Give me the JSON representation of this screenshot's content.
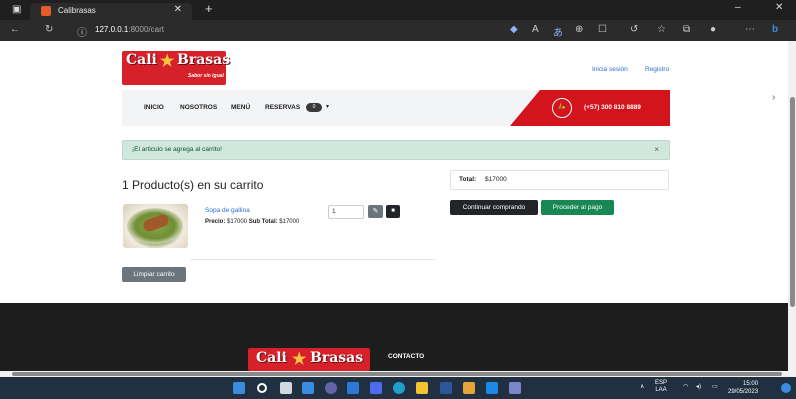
{
  "browser": {
    "tab_title": "Calibrasas",
    "tab_close": "✕",
    "new_tab": "+",
    "url_host": "127.0.0.1",
    "url_rest": ":8000/cart",
    "window": {
      "minimize": "–",
      "close": "✕"
    }
  },
  "site": {
    "logo": {
      "word1": "Cali",
      "word2": "Brasas",
      "tagline": "Sabor sin igual"
    },
    "links": {
      "login": "Inicia sesión",
      "register": "Registro"
    },
    "nav": {
      "items": [
        "INICIO",
        "NOSOTROS",
        "MENÚ",
        "RESERVAS"
      ],
      "badge": "0",
      "caret": "▾",
      "phone_icon": "🛵",
      "phone": "(+57) 300 810 8889"
    }
  },
  "alert": {
    "message": "¡El articulo se agrega al carrito!",
    "close": "×"
  },
  "cart": {
    "title": "1 Producto(s) en su carrito",
    "item": {
      "name": "Sopa de gallina",
      "price_label": "Precio:",
      "price": "$17000",
      "subtotal_label": "Sub Total:",
      "subtotal": "$17000",
      "quantity": "1",
      "edit_icon": "✎",
      "delete_icon": "■"
    },
    "clear_button": "Limpiar carrito"
  },
  "summary": {
    "total_label": "Total:",
    "total_value": "$17000",
    "continue_button": "Continuar comprando",
    "checkout_button": "Proceder al pago"
  },
  "footer": {
    "contact": "CONTACTO"
  },
  "taskbar": {
    "language": "ESP",
    "region": "LAA",
    "time": "15:00",
    "date": "29/05/2023"
  },
  "colors": {
    "brand_red": "#d4141c",
    "success_green": "#198754",
    "alert_bg": "#d1e7dd",
    "dark": "#212529"
  }
}
